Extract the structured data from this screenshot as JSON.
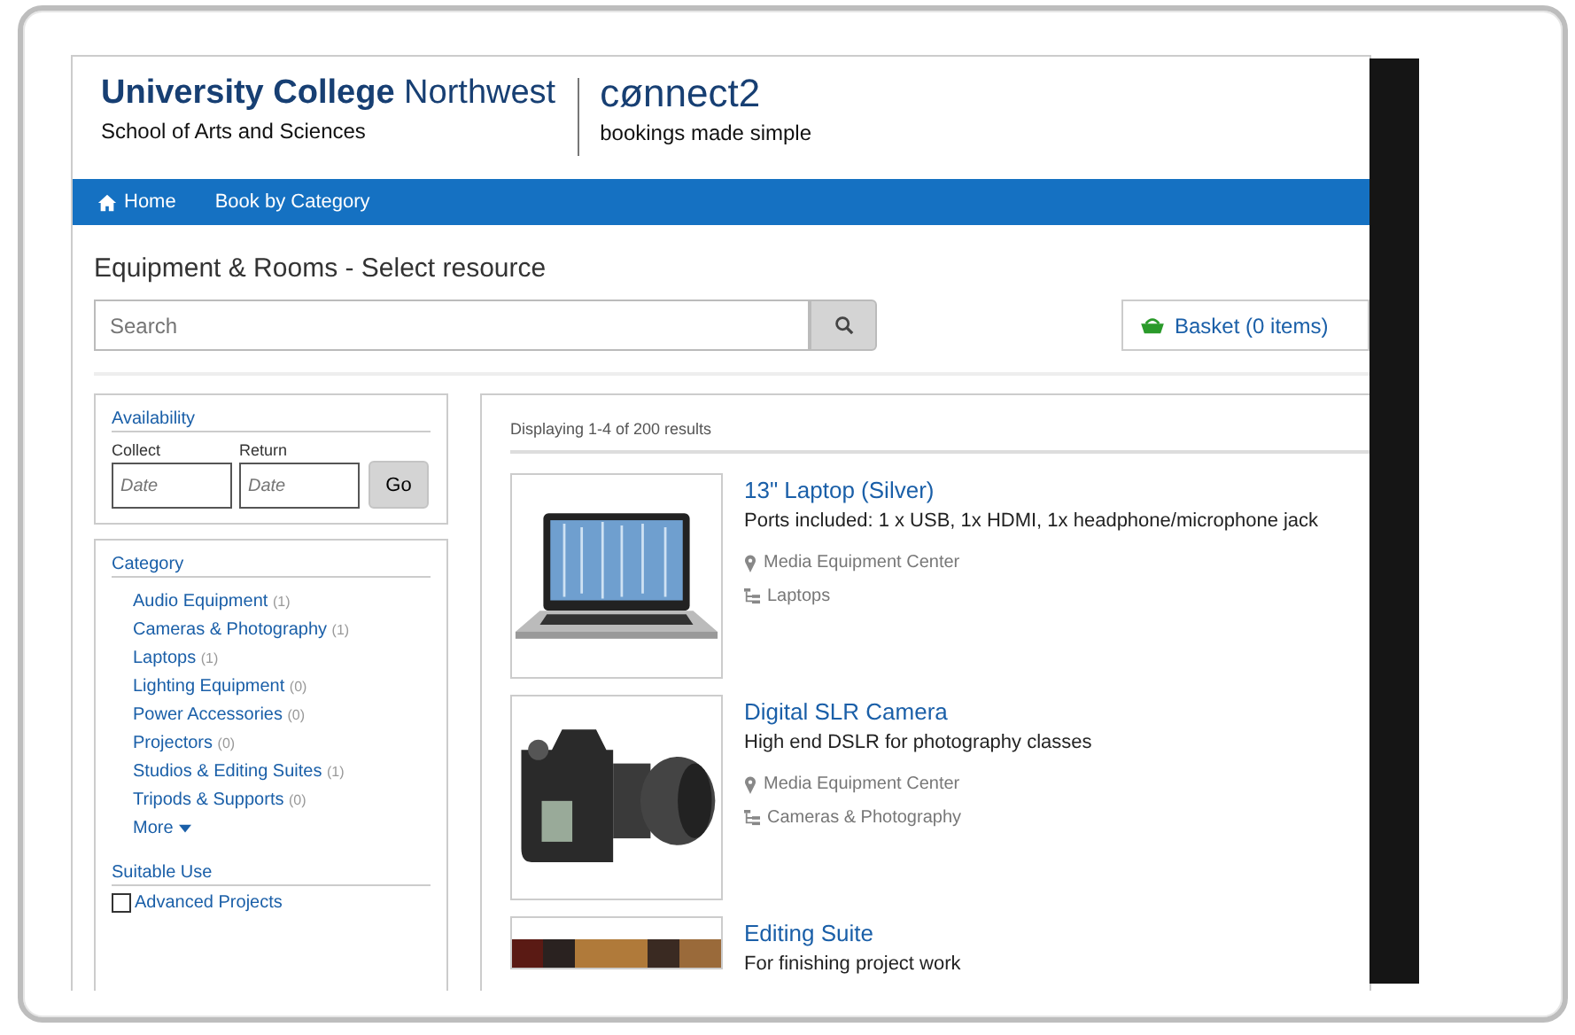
{
  "header": {
    "title_bold": "University College",
    "title_regular": "Northwest",
    "subtitle": "School of Arts and Sciences"
  },
  "brand": {
    "name": "cønnect2",
    "tagline": "bookings made simple"
  },
  "nav": [
    {
      "label": "Home",
      "kind": "home"
    },
    {
      "label": "Book by Category",
      "kind": "link"
    }
  ],
  "page_title": "Equipment & Rooms - Select resource",
  "search": {
    "placeholder": "Search"
  },
  "basket": {
    "label": "Basket (0 items)"
  },
  "availability": {
    "title": "Availability",
    "fields": [
      {
        "label": "Collect",
        "placeholder": "Date"
      },
      {
        "label": "Return",
        "placeholder": "Date"
      }
    ],
    "button": "Go"
  },
  "category": {
    "title": "Category",
    "items": [
      {
        "label": "Audio Equipment",
        "count": "(1)"
      },
      {
        "label": "Cameras & Photography",
        "count": "(1)"
      },
      {
        "label": "Laptops",
        "count": "(1)"
      },
      {
        "label": "Lighting Equipment",
        "count": "(0)"
      },
      {
        "label": "Power Accessories",
        "count": "(0)"
      },
      {
        "label": "Projectors",
        "count": "(0)"
      },
      {
        "label": "Studios & Editing Suites",
        "count": "(1)"
      },
      {
        "label": "Tripods & Supports",
        "count": "(0)"
      }
    ],
    "more": "More"
  },
  "suitable_use": {
    "title": "Suitable Use",
    "items": [
      {
        "label": "Advanced Projects",
        "checked": false
      }
    ]
  },
  "results": {
    "summary": "Displaying 1-4 of 200 results",
    "items": [
      {
        "kind": "laptop",
        "title": "13\" Laptop (Silver)",
        "description": "Ports included: 1 x USB, 1x HDMI, 1x headphone/microphone jack",
        "location": "Media Equipment Center",
        "category": "Laptops"
      },
      {
        "kind": "camera",
        "title": "Digital SLR Camera",
        "description": "High end DSLR for photography classes",
        "location": "Media Equipment Center",
        "category": "Cameras & Photography"
      },
      {
        "kind": "photo",
        "title": "Editing Suite",
        "description": "For finishing project work"
      }
    ]
  }
}
